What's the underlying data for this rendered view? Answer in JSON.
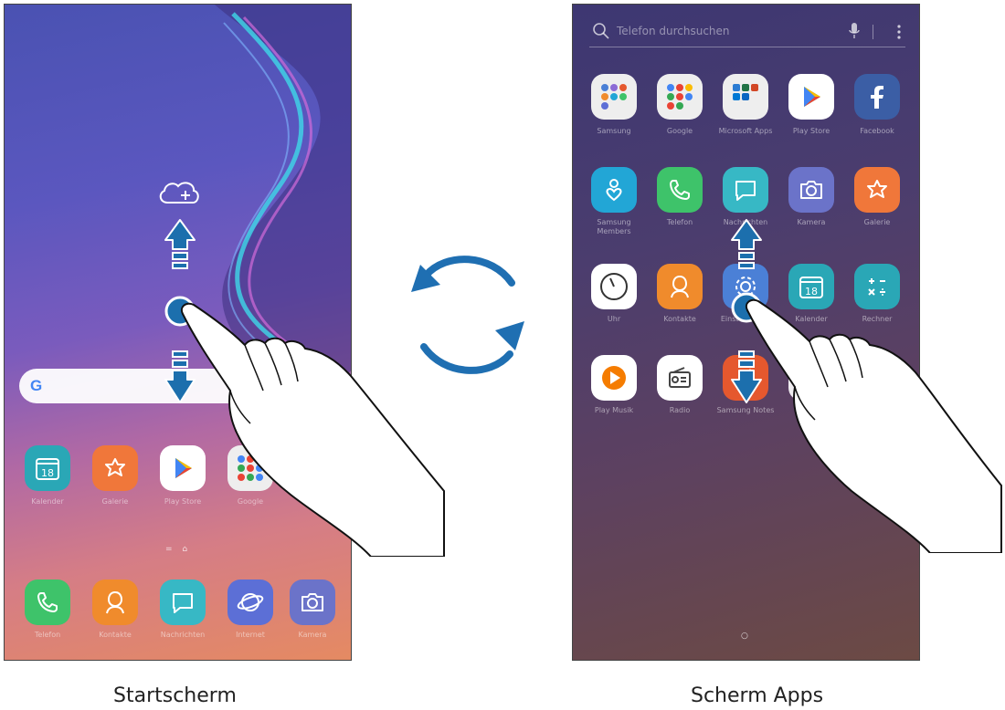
{
  "home": {
    "search_bar": {
      "logo": "G"
    },
    "page_indicator": "= ⌂",
    "apps": [
      {
        "label": "Kalender",
        "icon": "calendar-icon",
        "text": "18",
        "color": "#2aa7b6"
      },
      {
        "label": "Galerie",
        "icon": "gallery-flower-icon",
        "color": "#f0773a"
      },
      {
        "label": "Play Store",
        "icon": "play-store-icon",
        "color": "#ffffff"
      },
      {
        "label": "Google",
        "icon": "google-folder-icon",
        "color": "#eeeeee"
      }
    ],
    "dock": [
      {
        "label": "Telefon",
        "icon": "phone-icon",
        "color": "#3ec36a"
      },
      {
        "label": "Kontakte",
        "icon": "contacts-icon",
        "color": "#f08b2c"
      },
      {
        "label": "Nachrichten",
        "icon": "messages-icon",
        "color": "#37b8c5"
      },
      {
        "label": "Internet",
        "icon": "internet-icon",
        "color": "#5c6fd6"
      },
      {
        "label": "Kamera",
        "icon": "camera-icon",
        "color": "#6b73c9"
      }
    ]
  },
  "apps_screen": {
    "search_placeholder": "Telefon durchsuchen",
    "page_indicator": "○",
    "rows": [
      [
        {
          "label": "Samsung",
          "icon": "samsung-folder-icon",
          "color": "#eeeeee"
        },
        {
          "label": "Google",
          "icon": "google-folder-icon",
          "color": "#eeeeee"
        },
        {
          "label": "Microsoft Apps",
          "icon": "microsoft-folder-icon",
          "color": "#eeeeee"
        },
        {
          "label": "Play Store",
          "icon": "play-store-icon",
          "color": "#ffffff"
        },
        {
          "label": "Facebook",
          "icon": "facebook-icon",
          "color": "#3b5ea5"
        }
      ],
      [
        {
          "label": "Samsung Members",
          "icon": "samsung-members-icon",
          "color": "#22a6d6"
        },
        {
          "label": "Telefon",
          "icon": "phone-icon",
          "color": "#3ec36a"
        },
        {
          "label": "Nachrichten",
          "icon": "messages-icon",
          "color": "#37b8c5"
        },
        {
          "label": "Kamera",
          "icon": "camera-icon",
          "color": "#6b73c9"
        },
        {
          "label": "Galerie",
          "icon": "gallery-flower-icon",
          "color": "#f0773a"
        }
      ],
      [
        {
          "label": "Uhr",
          "icon": "clock-icon",
          "color": "#ffffff"
        },
        {
          "label": "Kontakte",
          "icon": "contacts-icon",
          "color": "#f08b2c"
        },
        {
          "label": "Einstellungen",
          "icon": "settings-icon",
          "color": "#4b80d6"
        },
        {
          "label": "Kalender",
          "icon": "calendar-icon",
          "color": "#2aa7b6",
          "text": "18"
        },
        {
          "label": "Rechner",
          "icon": "calculator-icon",
          "color": "#2aa7b6"
        }
      ],
      [
        {
          "label": "Play Musik",
          "icon": "play-music-icon",
          "color": "#ffffff"
        },
        {
          "label": "Radio",
          "icon": "radio-icon",
          "color": "#ffffff"
        },
        {
          "label": "Samsung Notes",
          "icon": "samsung-notes-icon",
          "color": "#e5582e"
        },
        {
          "label": "",
          "icon": "",
          "color": "#ffffff"
        },
        {
          "label": "",
          "icon": "",
          "color": "#ffffff"
        }
      ]
    ]
  },
  "captions": {
    "left": "Startscherm",
    "right": "Scherm Apps"
  },
  "colors": {
    "arrow_blue": "#1c6fad",
    "swap_blue": "#1f6fb2"
  }
}
